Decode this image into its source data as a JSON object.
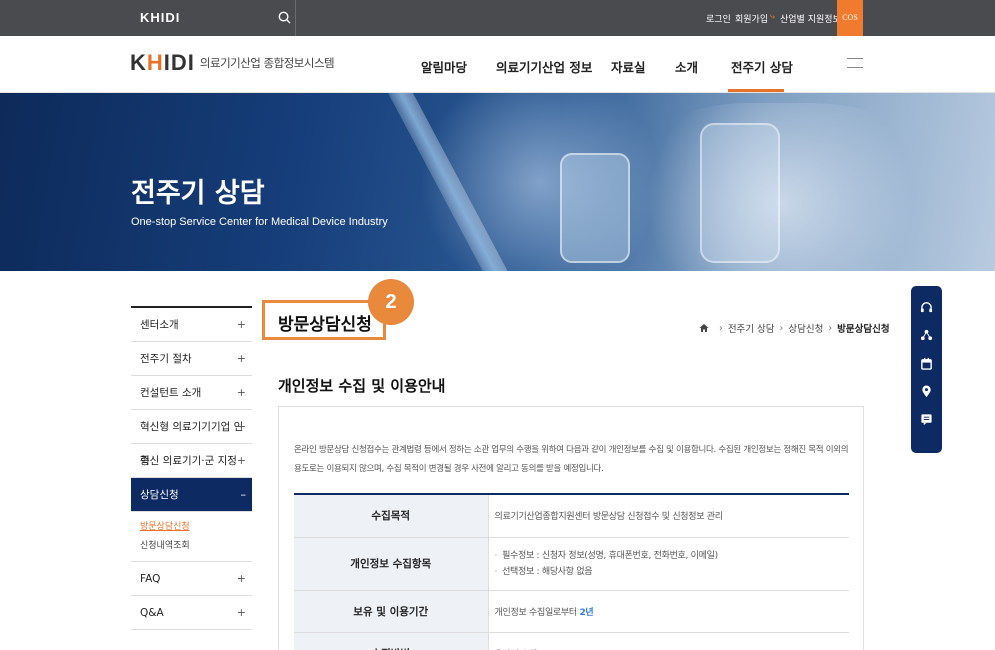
{
  "topbar": {
    "logo": "KHIDI",
    "links": {
      "login": "로그인",
      "join": "회원가입",
      "support": "산업별 지원정보"
    },
    "cos": "COS"
  },
  "header": {
    "brand_mark_left": "K",
    "brand_mark_accent": "H",
    "brand_mark_right": "IDI",
    "system_name": "의료기기산업 종합정보시스템",
    "nav": [
      "알림마당",
      "의료기기산업 정보",
      "자료실",
      "소개",
      "전주기 상담"
    ]
  },
  "hero": {
    "title": "전주기 상담",
    "subtitle": "One-stop Service Center for Medical Device Industry"
  },
  "sidebar": {
    "items": [
      {
        "label": "센터소개",
        "toggle": "+"
      },
      {
        "label": "전주기 절차",
        "toggle": "+"
      },
      {
        "label": "컨설턴트 소개",
        "toggle": "+"
      },
      {
        "label": "혁신형 의료기기기업 인증",
        "toggle": "+"
      },
      {
        "label": "혁신 의료기기·군 지정",
        "toggle": "+"
      },
      {
        "label": "상담신청",
        "toggle": "–"
      },
      {
        "label": "FAQ",
        "toggle": "+"
      },
      {
        "label": "Q&A",
        "toggle": "+"
      }
    ],
    "sub_items": [
      "방문상담신청",
      "신청내역조회"
    ]
  },
  "content": {
    "page_title": "방문상담신청",
    "step_badge": "2",
    "breadcrumb": [
      "전주기 상담",
      "상담신청",
      "방문상담신청"
    ],
    "section_title": "개인정보 수집 및 이용안내",
    "notice": "온라인 방문상담 신청접수는 관계법령 등에서 정하는 소관 업무의 수행을 위하여 다음과 같이 개인정보를 수집 및 이용합니다. 수집된 개인정보는 정해진 목적 이외의 용도로는 이용되지 않으며, 수집 목적이 변경될 경우 사전에 알리고 동의를 받을 예정입니다.",
    "table": {
      "purpose_label": "수집목적",
      "purpose_value": "의료기기산업종합지원센터 방문상담 신청접수 및 신청정보 관리",
      "items_label": "개인정보 수집항목",
      "items_values": [
        "필수정보 : 신청자 정보(성명, 휴대폰번호, 전화번호, 이메일)",
        "선택정보 : 해당사항 없음"
      ],
      "retention_label": "보유 및 이용기간",
      "retention_value_prefix": "개인정보 수집일로부터 ",
      "retention_value_highlight": "2년",
      "method_label": "수집방법",
      "method_value": "온라인 수집"
    }
  },
  "colors": {
    "accent": "#e8722a",
    "navy": "#0e2a62",
    "highlight_box": "#e8893c"
  },
  "quick_menu_icons": [
    "headset-icon",
    "network-icon",
    "calendar-icon",
    "location-icon",
    "chat-icon"
  ]
}
